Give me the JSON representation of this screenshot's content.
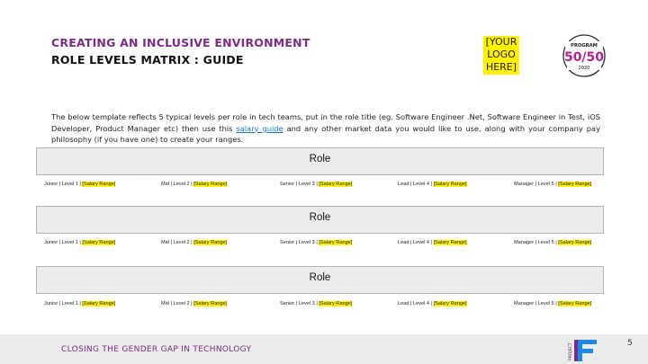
{
  "header": {
    "title_line1": "CREATING AN INCLUSIVE ENVIRONMENT",
    "title_line2": "ROLE LEVELS MATRIX : GUIDE",
    "logo_placeholder": [
      "[YOUR",
      "LOGO",
      "HERE]"
    ],
    "program_logo": {
      "top": "PROGRAM",
      "number": "50/50",
      "year": "2020"
    }
  },
  "intro": {
    "text_before": "The below template reflects 5 typical levels per role in tech teams, put in the role title (eg. Software Engineer .Net, Software Engineer in Test, iOS Developer, Product Manager etc) then use this ",
    "link_text": "salary guide",
    "text_after": " and any other market data you would like to use, along with your company pay philosophy (if you have one) to create your ranges."
  },
  "matrices": [
    {
      "title": "Role",
      "levels": [
        {
          "label": "Junior | Level 1 | ",
          "range": "[Salary Range]"
        },
        {
          "label": "Mid | Level 2 | ",
          "range": "[Salary Range]"
        },
        {
          "label": "Senior | Level 3 | ",
          "range": "[Salary Range]"
        },
        {
          "label": "Lead | Level 4 | ",
          "range": "[Salary Range]"
        },
        {
          "label": "Manager | Level 5 | ",
          "range": "[Salary Range]"
        }
      ]
    },
    {
      "title": "Role",
      "levels": [
        {
          "label": "Junior | Level 1 | ",
          "range": "[Salary Range]"
        },
        {
          "label": "Mid | Level 2 | ",
          "range": "[Salary Range]"
        },
        {
          "label": "Senior | Level 3 | ",
          "range": "[Salary Range]"
        },
        {
          "label": "Lead | Level 4 | ",
          "range": "[Salary Range]"
        },
        {
          "label": "Manager | Level 5 | ",
          "range": "[Salary Range]"
        }
      ]
    },
    {
      "title": "Role",
      "levels": [
        {
          "label": "Junior | Level 1 | ",
          "range": "[Salary Range]"
        },
        {
          "label": "Mid | Level 2 | ",
          "range": "[Salary Range]"
        },
        {
          "label": "Senior | Level 3 | ",
          "range": "[Salary Range]"
        },
        {
          "label": "Lead | Level 4 | ",
          "range": "[Salary Range]"
        },
        {
          "label": "Manager | Level 5 | ",
          "range": "[Salary Range]"
        }
      ]
    }
  ],
  "footer": {
    "text": "CLOSING THE GENDER GAP IN TECHNOLOGY",
    "brand_side_text": "PROJECT",
    "page_number": "5"
  },
  "colors": {
    "accent_purple": "#7a2b84",
    "highlight_yellow": "#fff200",
    "brand_blue": "#1e88e5",
    "link_blue": "#1a73c8"
  }
}
